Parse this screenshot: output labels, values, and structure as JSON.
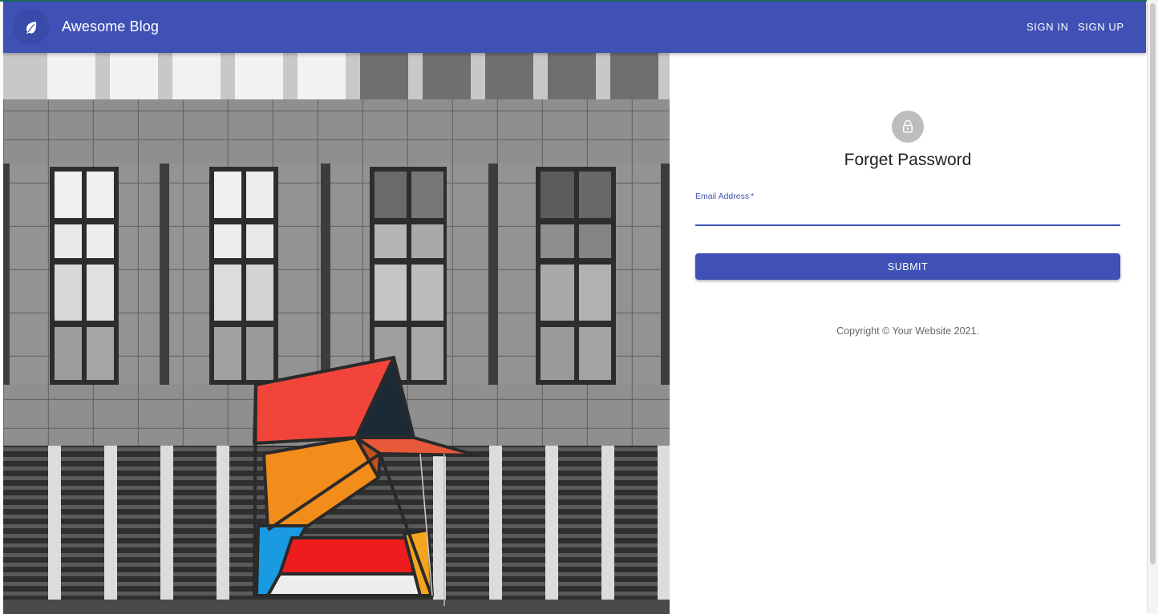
{
  "appbar": {
    "brand_label": "Awesome Blog",
    "logo_icon": "leaf-icon",
    "nav": {
      "sign_in": "Sign In",
      "sign_up": "Sign Up"
    },
    "color": "#3f51b5"
  },
  "hero": {
    "icon": "building-facade-sculpture-image"
  },
  "form": {
    "avatar_icon": "lock-icon",
    "title": "Forget Password",
    "email": {
      "label": "Email Address",
      "required_marker": "*",
      "value": ""
    },
    "submit_label": "SUBMIT"
  },
  "footer": {
    "copyright": "Copyright © Your Website 2021."
  },
  "colors": {
    "primary": "#3f51b5",
    "avatar_bg": "#bdbdbd",
    "sculpture_red": "#f2453a",
    "sculpture_orange": "#f28c1b",
    "sculpture_blue": "#1a9ae0"
  }
}
